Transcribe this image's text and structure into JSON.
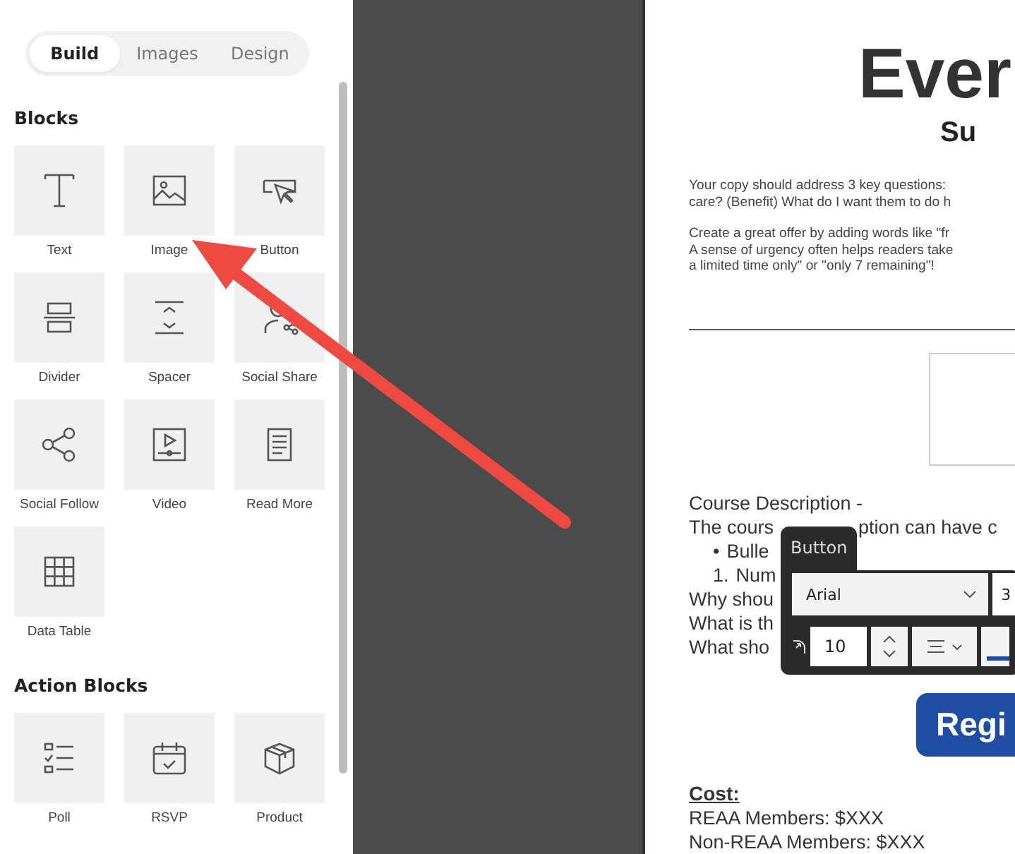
{
  "tabs": [
    {
      "label": "Build",
      "selected": true
    },
    {
      "label": "Images",
      "selected": false
    },
    {
      "label": "Design",
      "selected": false
    }
  ],
  "sections": [
    {
      "title": "Blocks",
      "blocks": [
        {
          "label": "Text",
          "kind": "text"
        },
        {
          "label": "Image",
          "kind": "image"
        },
        {
          "label": "Button",
          "kind": "button"
        },
        {
          "label": "Divider",
          "kind": "divider"
        },
        {
          "label": "Spacer",
          "kind": "spacer"
        },
        {
          "label": "Social Share",
          "kind": "share"
        },
        {
          "label": "Social Follow",
          "kind": "follow"
        },
        {
          "label": "Video",
          "kind": "video"
        },
        {
          "label": "Read More",
          "kind": "readmore"
        },
        {
          "label": "Data Table",
          "kind": "table"
        }
      ]
    },
    {
      "title": "Action Blocks",
      "blocks": [
        {
          "label": "Poll",
          "kind": "poll"
        },
        {
          "label": "RSVP",
          "kind": "rsvp"
        },
        {
          "label": "Product",
          "kind": "product"
        }
      ]
    }
  ],
  "canvas": {
    "title": "Ever",
    "subtitle": "Su",
    "paragraphs": [
      [
        "Your copy should address 3 key questions:",
        "care? (Benefit) What do I want them to do h"
      ],
      [
        "Create a great offer by adding words like \"fr",
        "A sense of urgency often helps readers take",
        "a limited time only\" or \"only 7 remaining\"!"
      ]
    ],
    "description_heading": "Course Description -",
    "lines": [
      {
        "text": "The cours",
        "after": "ption can have c"
      },
      {
        "marker": "•",
        "text": "Bulle"
      },
      {
        "marker": "1.",
        "text": "Num"
      },
      {
        "text": "Why shou"
      },
      {
        "text": "What is th"
      },
      {
        "text": "What sho"
      }
    ],
    "register_button": "Regi",
    "cost_heading": "Cost:",
    "cost_lines": [
      "REAA Members: $XXX",
      "Non-REAA Members: $XXX"
    ]
  },
  "toolbar": {
    "tab": "Button",
    "font": "Arial",
    "size": "3",
    "spacing": "10"
  }
}
